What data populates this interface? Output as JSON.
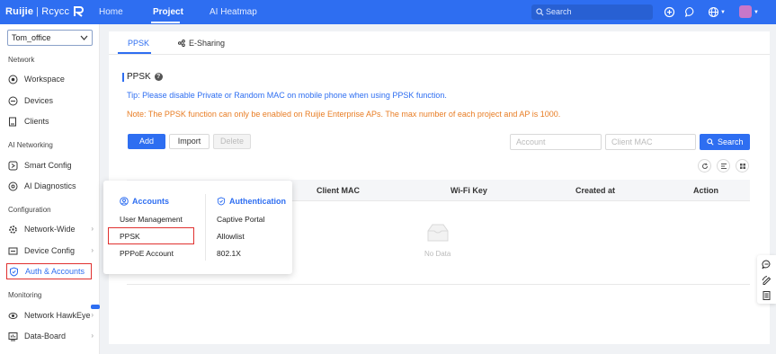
{
  "topbar": {
    "logo_left": "Ruijie",
    "logo_sep": "|",
    "logo_right": "Rcycc",
    "nav": [
      "Home",
      "Project",
      "AI Heatmap"
    ],
    "active_nav": "Project",
    "search_placeholder": "Search",
    "avatar_color": "#c977c9"
  },
  "sidebar": {
    "project": "Tom_office",
    "sections": [
      {
        "title": "Network",
        "items": [
          {
            "label": "Workspace",
            "icon": "workspace-icon"
          },
          {
            "label": "Devices",
            "icon": "devices-icon"
          },
          {
            "label": "Clients",
            "icon": "clients-icon"
          }
        ]
      },
      {
        "title": "AI Networking",
        "items": [
          {
            "label": "Smart Config",
            "icon": "smart-config-icon"
          },
          {
            "label": "AI Diagnostics",
            "icon": "ai-diagnostics-icon"
          }
        ]
      },
      {
        "title": "Configuration",
        "items": [
          {
            "label": "Network-Wide",
            "icon": "network-wide-icon"
          },
          {
            "label": "Device Config",
            "icon": "device-config-icon"
          },
          {
            "label": "Auth & Accounts",
            "icon": "shield-icon"
          }
        ]
      },
      {
        "title": "Monitoring",
        "items": [
          {
            "label": "Network HawkEye",
            "icon": "hawkeye-icon"
          },
          {
            "label": "Data-Board",
            "icon": "data-board-icon"
          }
        ]
      }
    ]
  },
  "main": {
    "tabs": [
      "PPSK",
      "E-Sharing"
    ],
    "active_tab": "PPSK",
    "title": "PPSK",
    "tip": "Tip: Please disable Private or Random MAC on mobile phone when using PPSK function.",
    "note": "Note: The PPSK function can only be enabled on Ruijie Enterprise APs. The max number of each project and AP is 1000.",
    "buttons": {
      "add": "Add",
      "import": "Import",
      "delete": "Delete",
      "search": "Search"
    },
    "filters": {
      "account_placeholder": "Account",
      "mac_placeholder": "Client MAC"
    },
    "table": {
      "columns": [
        "Client MAC",
        "Wi-Fi Key",
        "Created at",
        "Action"
      ],
      "empty_text": "No Data"
    }
  },
  "popover": {
    "accounts_title": "Accounts",
    "accounts_items": [
      "User Management",
      "PPSK",
      "PPPoE Account"
    ],
    "auth_title": "Authentication",
    "auth_items": [
      "Captive Portal",
      "Allowlist",
      "802.1X"
    ]
  },
  "colors": {
    "accent": "#2e6ef1",
    "warning": "#e87d24",
    "highlight": "#e0302f"
  }
}
